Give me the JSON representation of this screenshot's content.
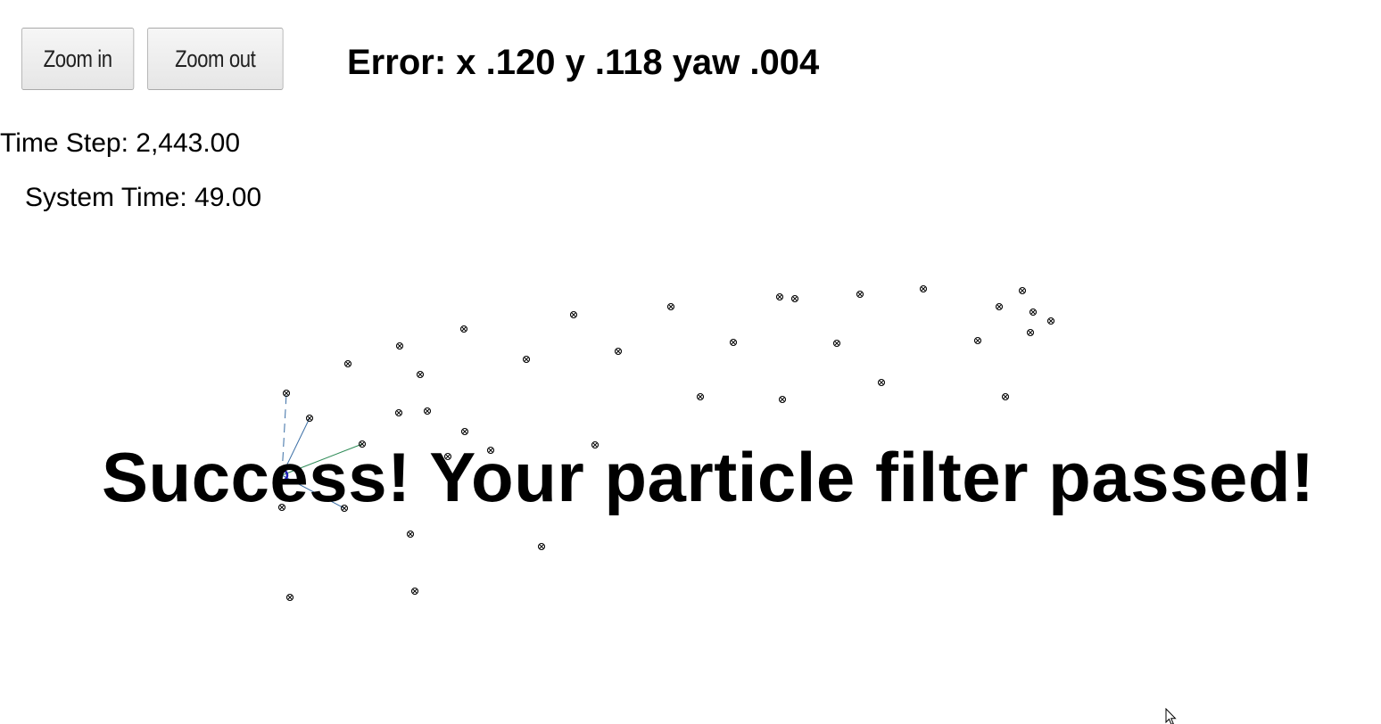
{
  "controls": {
    "zoom_in_label": "Zoom in",
    "zoom_out_label": "Zoom out"
  },
  "status": {
    "error_text": "Error: x .120 y .118 yaw .004",
    "time_step_text": "Time Step: 2,443.00",
    "system_time_text": "System Time: 49.00"
  },
  "message": {
    "success_text": "Success! Your particle filter passed!"
  },
  "colors": {
    "vehicle": "#1f1fb4",
    "landmark": "#000000",
    "observation_near": "#2e8b57",
    "observation_far": "#3a6ea5",
    "background": "#ffffff"
  },
  "icons": {
    "pointer": "mouse-pointer-icon",
    "landmark": "landmark-marker-icon",
    "vehicle": "vehicle-marker-icon"
  }
}
